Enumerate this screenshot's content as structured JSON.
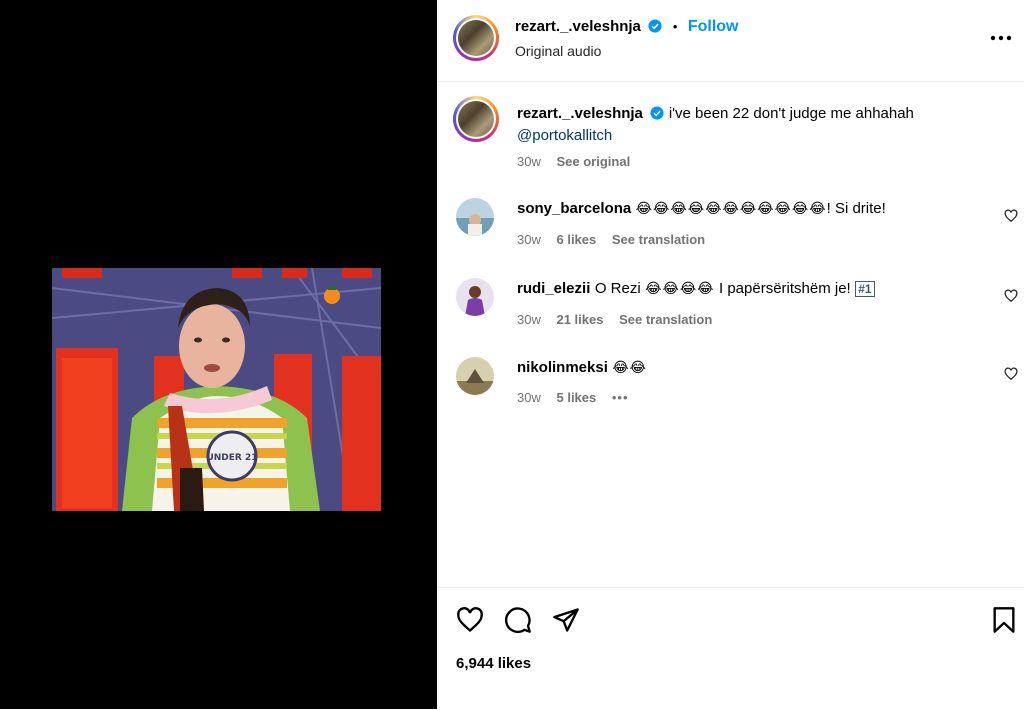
{
  "header": {
    "username": "rezart._.veleshnja",
    "separator": "•",
    "follow_label": "Follow",
    "subtitle": "Original audio"
  },
  "caption": {
    "username": "rezart._.veleshnja",
    "text": "i've been 22 don't judge me ahhahah",
    "mention": "@portokallitch",
    "time": "30w",
    "see_original": "See original"
  },
  "comments": [
    {
      "username": "sony_barcelona",
      "emojis": "😂😂😂😂😂😂😂😂😂😂😂",
      "text": "! Si drite!",
      "time": "30w",
      "likes": "6 likes",
      "action": "See translation"
    },
    {
      "username": "rudi_elezii",
      "text": "O Rezi",
      "emojis": "😂😂😂😂",
      "text2": "I papërsëritshëm je!",
      "badge": "#1",
      "time": "30w",
      "likes": "21 likes",
      "action": "See translation"
    },
    {
      "username": "nikolinmeksi",
      "emojis": "😂😂",
      "time": "30w",
      "likes": "5 likes",
      "more": "•••"
    }
  ],
  "footer": {
    "likes_count": "6,944 likes"
  },
  "video_overlay": {
    "shirt_text": "UNDER 21"
  },
  "colors": {
    "follow": "#0095f6",
    "link": "#00376b",
    "meta": "#737373",
    "verified": "#0095f6"
  },
  "icons": [
    "more-icon",
    "verified-icon",
    "heart-icon",
    "comment-icon",
    "share-icon",
    "bookmark-icon"
  ]
}
